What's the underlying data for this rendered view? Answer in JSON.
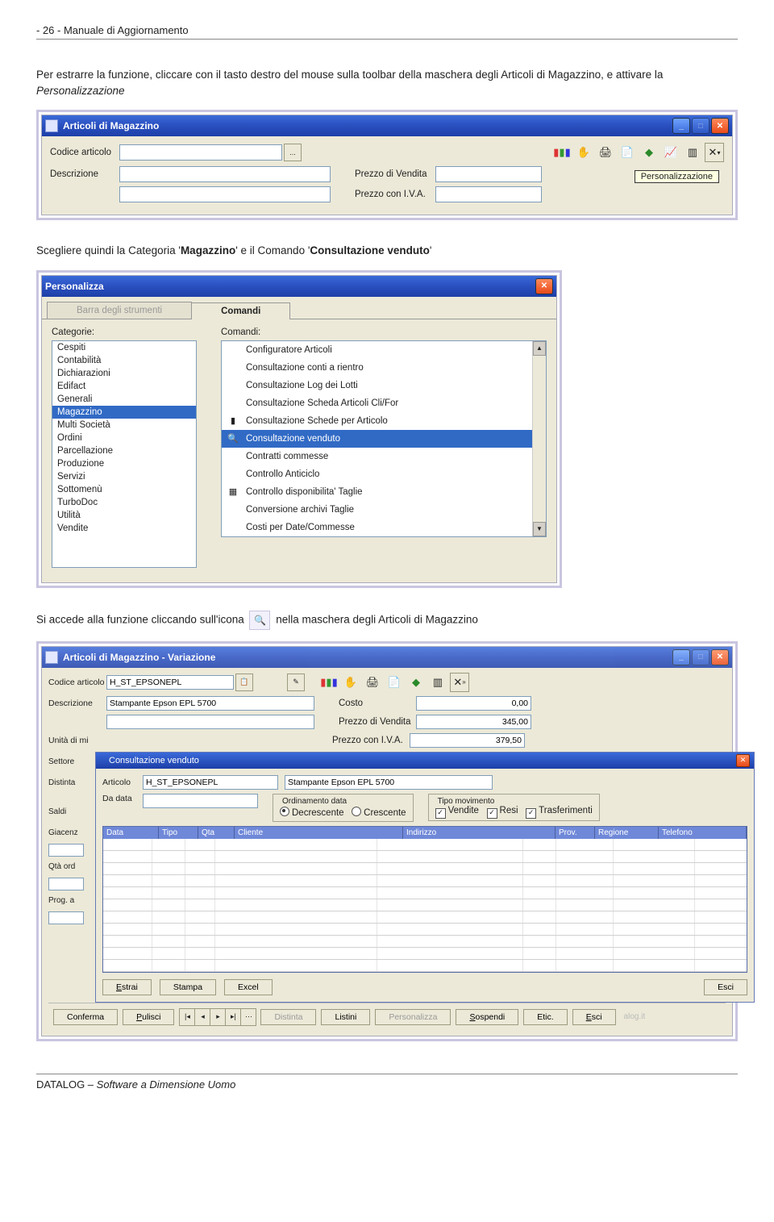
{
  "header": "- 26 -  Manuale di Aggiornamento",
  "para1": "Per estrarre la funzione, cliccare con il tasto destro del mouse sulla toolbar della maschera degli Articoli di Magazzino, e attivare la ",
  "para1_em": "Personalizzazione",
  "shot1": {
    "title": "Articoli di Magazzino",
    "codice_lbl": "Codice articolo",
    "desc_lbl": "Descrizione",
    "prezzo_lbl": "Prezzo di Vendita",
    "iva_lbl": "Prezzo con I.V.A.",
    "browse": "...",
    "tooltip": "Personalizzazione"
  },
  "para2_a": "Scegliere quindi la Categoria '",
  "para2_b": "Magazzino",
  "para2_c": "' e il Comando '",
  "para2_d": "Consultazione venduto",
  "para2_e": "'",
  "shot2": {
    "title": "Personalizza",
    "tab1": "Barra degli strumenti",
    "tab2": "Comandi",
    "cat_lbl": "Categorie:",
    "cmd_lbl": "Comandi:",
    "cats": [
      "Cespiti",
      "Contabilità",
      "Dichiarazioni",
      "Edifact",
      "Generali",
      "Magazzino",
      "Multi Società",
      "Ordini",
      "Parcellazione",
      "Produzione",
      "Servizi",
      "Sottomenù",
      "TurboDoc",
      "Utilità",
      "Vendite"
    ],
    "cmds": [
      "Configuratore Articoli",
      "Consultazione conti a rientro",
      "Consultazione Log dei Lotti",
      "Consultazione Scheda Articoli Cli/For",
      "Consultazione Schede per Articolo",
      "Consultazione venduto",
      "Contratti commesse",
      "Controllo Anticiclo",
      "Controllo disponibilita' Taglie",
      "Conversione archivi Taglie",
      "Costi per Date/Commesse"
    ]
  },
  "para3_a": "Si accede alla funzione cliccando sull'icona ",
  "para3_b": " nella maschera degli Articoli di Magazzino",
  "shot3": {
    "title": "Articoli di Magazzino - Variazione",
    "codice_lbl": "Codice articolo",
    "codice_val": "H_ST_EPSONEPL",
    "desc_lbl": "Descrizione",
    "desc_val": "Stampante Epson EPL 5700",
    "costo_lbl": "Costo",
    "costo_val": "0,00",
    "pv_lbl": "Prezzo di Vendita",
    "pv_val": "345,00",
    "iva_lbl": "Prezzo con I.V.A.",
    "iva_val": "379,50",
    "unita_lbl": "Unità di mi",
    "settore_lbl": "Settore",
    "distinta_lbl": "Distinta",
    "saldi_lbl": "Saldi",
    "giac_lbl": "Giacenz",
    "qta_lbl": "Qtà ord",
    "prog_lbl": "Prog. a",
    "nested_title": "Consultazione venduto",
    "art_lbl": "Articolo",
    "art_val": "H_ST_EPSONEPL",
    "art_desc": "Stampante Epson EPL 5700",
    "dadata_lbl": "Da data",
    "ord_lbl": "Ordinamento data",
    "dec": "Decrescente",
    "cre": "Crescente",
    "tipo_lbl": "Tipo movimento",
    "vendite": "Vendite",
    "resi": "Resi",
    "trasf": "Trasferimenti",
    "gcols": [
      "Data",
      "Tipo",
      "Qta",
      "Cliente",
      "Indirizzo",
      "Prov.",
      "Regione",
      "Telefono"
    ],
    "estrai": "Estrai",
    "stampa": "Stampa",
    "excel": "Excel",
    "esci": "Esci",
    "conferma": "Conferma",
    "pulisci": "Pulisci",
    "distinta_btn": "Distinta",
    "listini": "Listini",
    "pers": "Personalizza",
    "sosp": "Sospendi",
    "etic": "Etic.",
    "watermark": "alog.it"
  },
  "footer": "DATALOG – Software a Dimensione Uomo"
}
